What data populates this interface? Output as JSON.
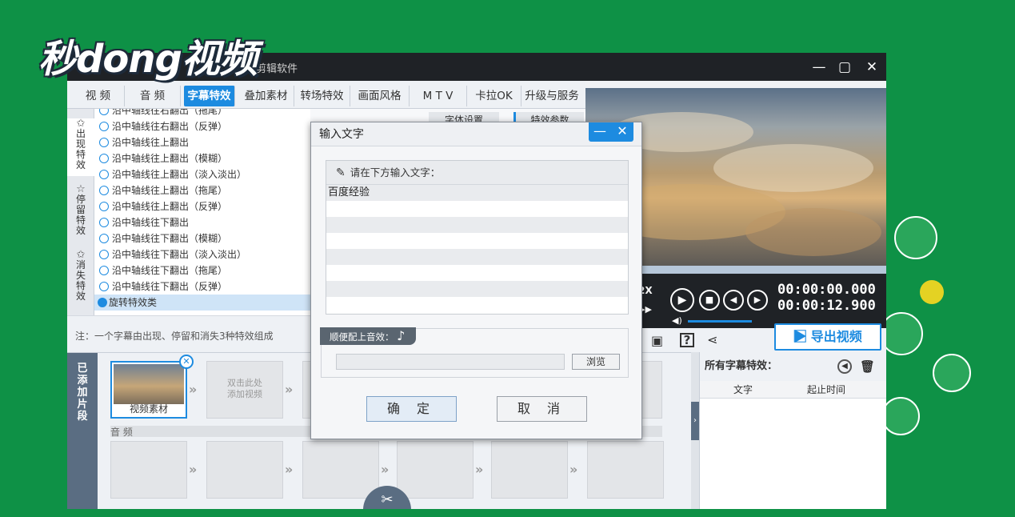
{
  "logo_text": "秒dong视频",
  "window": {
    "title_suffix": "剪辑软件",
    "minimize_glyph": "—",
    "maximize_glyph": "▢",
    "close_glyph": "✕"
  },
  "menu": {
    "items": [
      {
        "label": "视 频",
        "active": false
      },
      {
        "label": "音 频",
        "active": false
      },
      {
        "label": "字幕特效",
        "active": true
      },
      {
        "label": "叠加素材",
        "active": false
      },
      {
        "label": "转场特效",
        "active": false
      },
      {
        "label": "画面风格",
        "active": false
      },
      {
        "label": "M T V",
        "active": false
      },
      {
        "label": "卡拉OK",
        "active": false
      },
      {
        "label": "升级与服务",
        "active": false
      }
    ]
  },
  "sidebar_tabs": [
    {
      "icon": "✩",
      "label": "出现特效"
    },
    {
      "icon": "☆",
      "label": "停留特效"
    },
    {
      "icon": "✩",
      "label": "消失特效"
    }
  ],
  "effect_list": [
    "沿中轴线往右翻出（拖尾）",
    "沿中轴线往右翻出（反弹）",
    "沿中轴线往上翻出",
    "沿中轴线往上翻出（模糊）",
    "沿中轴线往上翻出（淡入淡出）",
    "沿中轴线往上翻出（拖尾）",
    "沿中轴线往上翻出（反弹）",
    "沿中轴线往下翻出",
    "沿中轴线往下翻出（模糊）",
    "沿中轴线往下翻出（淡入淡出）",
    "沿中轴线往下翻出（拖尾）",
    "沿中轴线往下翻出（反弹）"
  ],
  "effect_group": "旋转特效类",
  "right_panel_tabs": [
    "字体设置",
    "特效参数"
  ],
  "note": "注：一个字幕由出现、停留和消失3种特效组成",
  "player": {
    "speed": "2X",
    "time_current": "00:00:00.000",
    "time_total": "00:00:12.900"
  },
  "export_label": "导出视频",
  "timeline": {
    "add_tab": "已添加片段",
    "clip_label": "视频素材",
    "placeholder": "双击此处\n添加视频",
    "audio_label": "音 频"
  },
  "effects_panel": {
    "title": "所有字幕特效：",
    "col_text": "文字",
    "col_time": "起止时间"
  },
  "dialog": {
    "title": "输入文字",
    "prompt": "请在下方输入文字：",
    "text_value": "百度经验",
    "sound_tag": "顺便配上音效：",
    "browse": "浏览",
    "ok": "确 定",
    "cancel": "取 消"
  },
  "colors": {
    "background_green": "#0e9146",
    "accent_blue": "#1d8be0",
    "titlebar_dark": "#1f2226"
  }
}
